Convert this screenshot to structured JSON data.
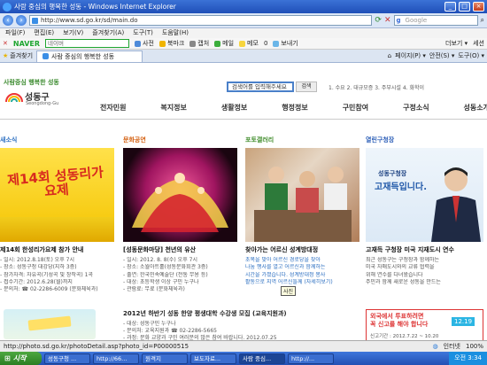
{
  "window": {
    "title": "사람 중심의 행복한 성동 - Windows Internet Explorer"
  },
  "address": {
    "url": "http://www.sd.go.kr/sd/main.do",
    "search_placeholder": "Google"
  },
  "menu": [
    "파일(F)",
    "편집(E)",
    "보기(V)",
    "즐겨찾기(A)",
    "도구(T)",
    "도움말(H)"
  ],
  "naver": {
    "logo": "NAVER",
    "placeholder": "네이버",
    "items": [
      "사전",
      "북마크",
      "캡처",
      "메일",
      "메모",
      "0",
      "보내기"
    ],
    "right": "더보기 ▾",
    "more": "세션"
  },
  "tabbar": {
    "favorites": "즐겨찾기",
    "tab_title": "사람 중심의 행복한 성동",
    "tools": [
      "페이지(P) ▾",
      "안전(S) ▾",
      "도구(O) ▾"
    ]
  },
  "site": {
    "slogan": "사람중심 행복한 성동",
    "name": "성동구",
    "name_en": "Seongdong-Gu",
    "search_placeholder": "검색어를 입력해주세요",
    "search_button": "검색",
    "top_keywords": "1. 수요  2. 대규모증  3. 주부시설  4. 화학이",
    "nav": [
      "전자민원",
      "복지정보",
      "생활정보",
      "행정정보",
      "구민참여",
      "구정소식",
      "성동소개"
    ]
  },
  "sections": [
    {
      "title": "새소식",
      "color": "#2c6fc1",
      "poster_text": "제14회 성동리가요제",
      "headline": "제14회 한성리가요제 참가 안내",
      "lines": [
        "- 일시: 2012.8.18(토) 오후 7시",
        "- 장소: 성동구청 대강당(지하 3층)",
        "- 참가자격: 자유곡(기성곡 및 창작곡) 1곡",
        "- 접수기간: 2012.6.28(월)까지",
        "- 문의처: ☎ 02-2286-6009 (문화체육과)"
      ]
    },
    {
      "title": "문화공연",
      "color": "#d46010",
      "headline": "[성동문화마당] 천년의 유산",
      "lines": [
        "- 일시: 2012. 8. 8(수) 오후 7시",
        "- 장소: 소월아트홀(성동문화회관 3층)",
        "- 출연: 한국민속예술단 (전통 무용 등)",
        "- 대상: 초등학생 이상 구민 누구나",
        "- 관람료: 무료 (문화체육과)"
      ]
    },
    {
      "title": "포토갤러리",
      "color": "#3f8c2a",
      "headline": "찾아가는 어르신 성계방대정",
      "lines": [
        "초복을 맞아 어르신 경로당을 찾아",
        "나눔 행사를 열고 어르신과 함께하는",
        "시간을 가졌습니다. 성계방대정 봉사",
        "활동으로 지역 어르신들께 (자세히보기)",
        "자세히보기"
      ],
      "tooltip": "사진"
    },
    {
      "title": "열린구청장",
      "color": "#2d5fb8",
      "banner_top": "성동구청장",
      "banner_main": "고재득입니다.",
      "headline": "고재득 구청장 미국 지재도시 연수",
      "lines": [
        "최근 성동구는 구청장과 함께하는",
        "미국 자매도시와의 교류 협력을",
        "위해 연수를 다녀왔습니다",
        "주민과 함께 새로운 성동을 만드는",
        "(자세히)"
      ]
    }
  ],
  "bottom": {
    "notice": "2012년 하반기 성동 한양 평생대학 수강생 모집 (교육지원과)",
    "notice_sub1": "- 대상: 성동구민 누구나",
    "notice_sub2": "- 문의처: 교육지원과 ☎ 02-2286-5665",
    "notice_sub3": "- 과정: 문화 교양과 구민 여러분의 많은 참여 바랍니다.  2012.07.25",
    "banner_line1": "외국에서 투표하려면",
    "banner_line2": "꼭 신고를 해야 합니다",
    "banner_dates": "12.19",
    "banner_sub": "신고기간 : 2012.7.22 ~ 10.20"
  },
  "status": {
    "url": "http://photo.sd.go.kr/photoDetail.asp?photo_id=P00000515",
    "zone": "인터넷",
    "zoom": "100%"
  },
  "taskbar": {
    "start": "시작",
    "tasks": [
      "성동구청 ...",
      "http://66...",
      "원격지",
      "보도자료...",
      "사람 중심...",
      "http://..."
    ],
    "clock": "오전 3:34"
  }
}
